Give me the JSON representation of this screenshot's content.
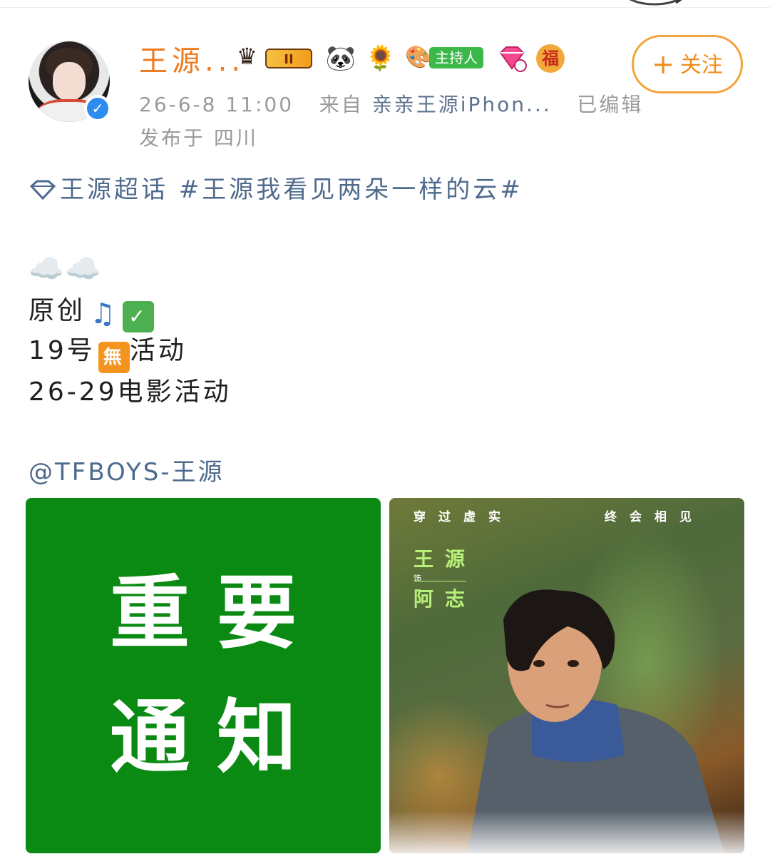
{
  "post": {
    "username": "王源...",
    "level_badge": "II",
    "host_badge_label": "主持人",
    "follow_label": "关注",
    "timestamp": "26-6-8 11:00",
    "source_prefix": "来自",
    "source_device": "亲亲王源iPhon...",
    "edited_label": "已编辑",
    "location": "发布于 四川"
  },
  "content": {
    "topic_line": "王源超话 #王源我看见两朵一样的云#",
    "clouds": "☁️☁️",
    "line1": "原创",
    "line2_a": "19号",
    "line2_wu": "無",
    "line2_b": "活动",
    "line3": "26-29电影活动",
    "mention": "@TFBOYS-王源"
  },
  "images": {
    "notice_line1": "重要",
    "notice_line2": "通知",
    "poster_tag_left": "穿过虚实",
    "poster_tag_right": "终会相见",
    "poster_actor": "王源",
    "poster_as": "饰",
    "poster_role": "阿志"
  },
  "colors": {
    "username": "#ee7b1f",
    "link": "#4e6a8c",
    "follow_border": "#f2a339",
    "notice_bg": "#0a8a12"
  }
}
